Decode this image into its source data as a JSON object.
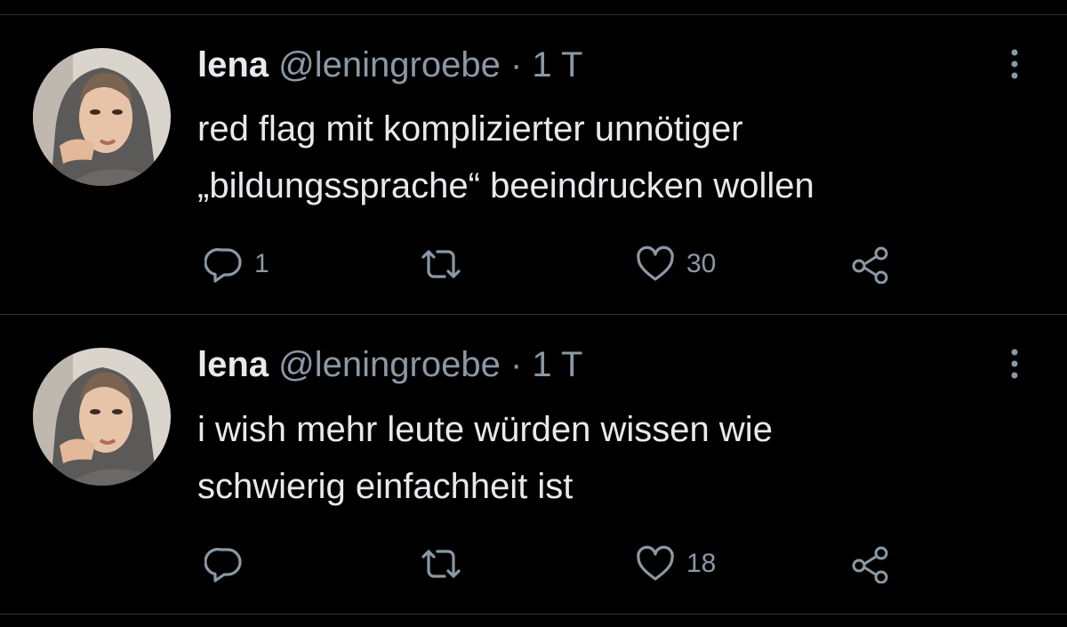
{
  "colors": {
    "background": "#000000",
    "text_primary": "#e7e9ea",
    "text_secondary": "#8b98a5",
    "divider": "#2f3336"
  },
  "tweets": [
    {
      "display_name": "lena",
      "handle": "@leningroebe",
      "separator": "·",
      "time": "1 T",
      "text": "red flag mit komplizierter unnötiger\n„bildungssprache“ beeindrucken wollen",
      "reply_count": "1",
      "retweet_count": "",
      "like_count": "30",
      "icons": [
        "reply-icon",
        "retweet-icon",
        "like-icon",
        "share-icon",
        "more-icon"
      ]
    },
    {
      "display_name": "lena",
      "handle": "@leningroebe",
      "separator": "·",
      "time": "1 T",
      "text": "i wish mehr leute würden wissen wie\nschwierig einfachheit ist",
      "reply_count": "",
      "retweet_count": "",
      "like_count": "18",
      "icons": [
        "reply-icon",
        "retweet-icon",
        "like-icon",
        "share-icon",
        "more-icon"
      ]
    }
  ]
}
